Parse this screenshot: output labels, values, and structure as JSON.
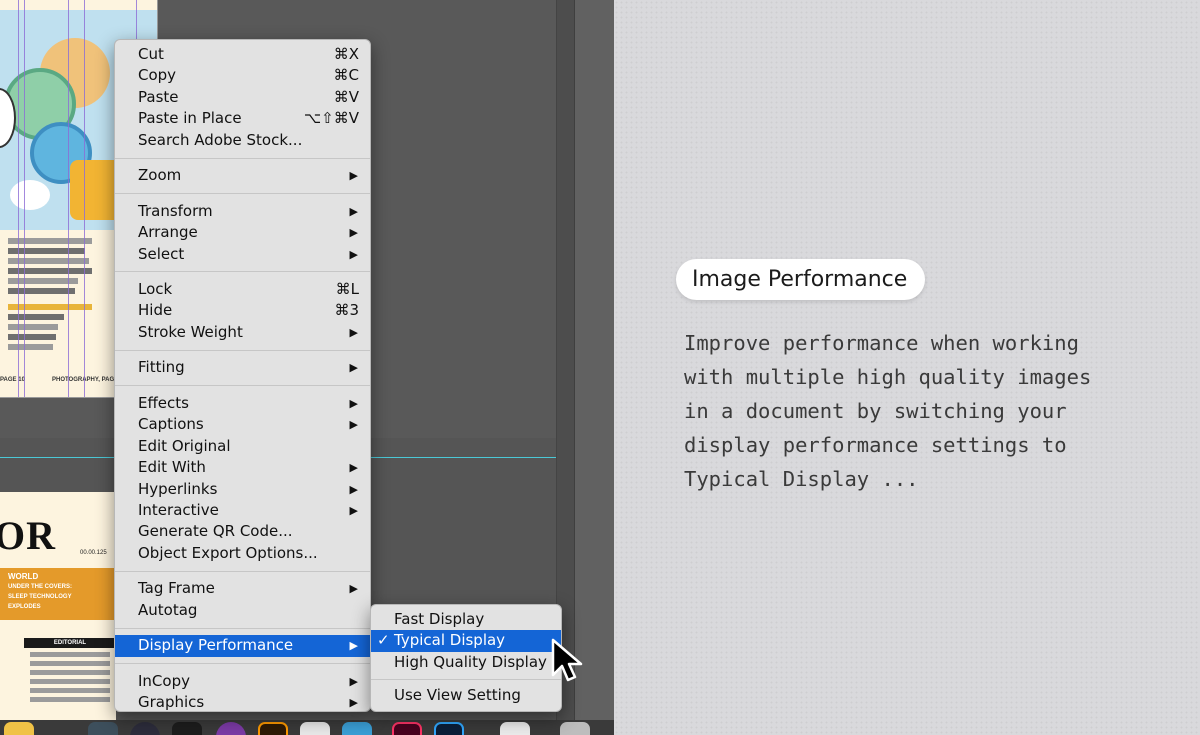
{
  "context_menu": {
    "groups": [
      [
        {
          "label": "Cut",
          "shortcut": "⌘X"
        },
        {
          "label": "Copy",
          "shortcut": "⌘C"
        },
        {
          "label": "Paste",
          "shortcut": "⌘V"
        },
        {
          "label": "Paste in Place",
          "shortcut": "⌥⇧⌘V"
        },
        {
          "label": "Search Adobe Stock...",
          "shortcut": ""
        }
      ],
      [
        {
          "label": "Zoom",
          "submenu": true
        }
      ],
      [
        {
          "label": "Transform",
          "submenu": true
        },
        {
          "label": "Arrange",
          "submenu": true
        },
        {
          "label": "Select",
          "submenu": true
        }
      ],
      [
        {
          "label": "Lock",
          "shortcut": "⌘L"
        },
        {
          "label": "Hide",
          "shortcut": "⌘3"
        },
        {
          "label": "Stroke Weight",
          "submenu": true
        }
      ],
      [
        {
          "label": "Fitting",
          "submenu": true
        }
      ],
      [
        {
          "label": "Effects",
          "submenu": true
        },
        {
          "label": "Captions",
          "submenu": true
        },
        {
          "label": "Edit Original"
        },
        {
          "label": "Edit With",
          "submenu": true
        },
        {
          "label": "Hyperlinks",
          "submenu": true
        },
        {
          "label": "Interactive",
          "submenu": true
        },
        {
          "label": "Generate QR Code..."
        },
        {
          "label": "Object Export Options..."
        }
      ],
      [
        {
          "label": "Tag Frame",
          "submenu": true
        },
        {
          "label": "Autotag"
        }
      ],
      [
        {
          "label": "Display Performance",
          "submenu": true,
          "highlighted": true
        }
      ],
      [
        {
          "label": "InCopy",
          "submenu": true
        },
        {
          "label": "Graphics",
          "submenu": true
        }
      ]
    ]
  },
  "display_performance_submenu": {
    "items": [
      {
        "label": "Fast Display",
        "checked": false
      },
      {
        "label": "Typical Display",
        "checked": true,
        "highlighted": true
      },
      {
        "label": "High Quality Display",
        "checked": false
      }
    ],
    "footer_item": {
      "label": "Use View Setting"
    }
  },
  "glyphs": {
    "submenu_arrow": "▶",
    "checkmark": "✓"
  },
  "document": {
    "page1_folio_left": "PAGE 10",
    "page1_folio_right": "PHOTOGRAPHY, PAGE",
    "page2_headline_fragment": "OR",
    "page2_counter": "00.00.125",
    "page2_orange_lines": [
      "WORLD",
      "UNDER THE COVERS:",
      "SLEEP TECHNOLOGY",
      "EXPLODES"
    ],
    "page2_tag": "EDITORIAL"
  },
  "info_panel": {
    "title": "Image Performance",
    "description": "Improve performance when working\nwith multiple high quality images\nin a document by switching your\ndisplay performance settings to\nTypical Display ..."
  },
  "colors": {
    "menu_highlight": "#1465d6",
    "accent_guide": "#4bc8d6",
    "panel_bg": "#d9d9dc"
  }
}
